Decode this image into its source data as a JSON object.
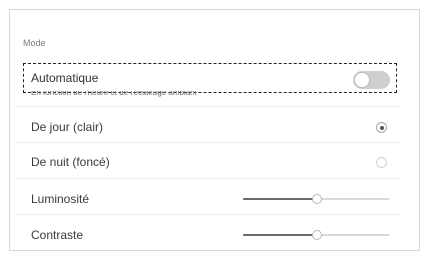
{
  "section": {
    "label": "Mode"
  },
  "automatic": {
    "label": "Automatique",
    "sublabel": "En fonction de l'heure et de l'éclairage ambiant",
    "enabled": false
  },
  "options": [
    {
      "label": "De jour (clair)",
      "selected": true
    },
    {
      "label": "De nuit (foncé)",
      "selected": false
    }
  ],
  "sliders": [
    {
      "label": "Luminosité",
      "value": 0.5
    },
    {
      "label": "Contraste",
      "value": 0.5
    }
  ],
  "colors": {
    "track": "#d9d9d9",
    "fill": "#6a6a6a",
    "toggle_off": "#cfcfcf"
  }
}
